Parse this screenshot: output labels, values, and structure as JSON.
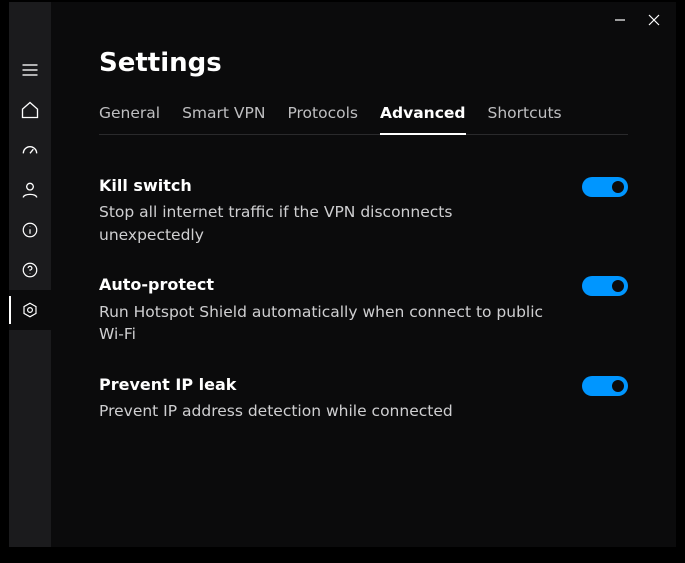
{
  "page_title": "Settings",
  "tabs": [
    {
      "label": "General",
      "active": false
    },
    {
      "label": "Smart VPN",
      "active": false
    },
    {
      "label": "Protocols",
      "active": false
    },
    {
      "label": "Advanced",
      "active": true
    },
    {
      "label": "Shortcuts",
      "active": false
    }
  ],
  "options": [
    {
      "title": "Kill switch",
      "desc": "Stop all internet traffic if the VPN disconnects unexpectedly",
      "on": true
    },
    {
      "title": "Auto-protect",
      "desc": "Run Hotspot Shield automatically when connect to public Wi-Fi",
      "on": true
    },
    {
      "title": "Prevent IP leak",
      "desc": "Prevent IP address detection while connected",
      "on": true
    }
  ],
  "colors": {
    "accent": "#0096ff"
  }
}
